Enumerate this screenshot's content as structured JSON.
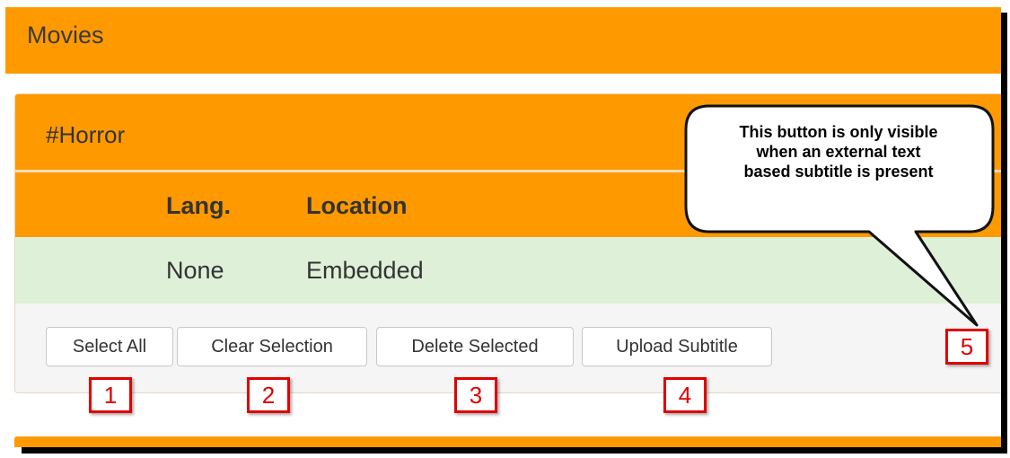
{
  "page": {
    "title": "Movies"
  },
  "panel": {
    "title": "#Horror"
  },
  "table": {
    "headers": [
      "Lang.",
      "Location"
    ],
    "rows": [
      {
        "lang": "None",
        "location": "Embedded"
      }
    ]
  },
  "buttons": {
    "select_all": "Select All",
    "clear_selection": "Clear Selection",
    "delete_selected": "Delete Selected",
    "upload_subtitle": "Upload Subtitle"
  },
  "annotations": {
    "labels": [
      "1",
      "2",
      "3",
      "4",
      "5"
    ],
    "callout": [
      "This button is only visible",
      "when an external text",
      "based subtitle is present"
    ]
  },
  "colors": {
    "accent": "#ff9900",
    "row_highlight": "#dff0d8",
    "annotation_red": "#e00000"
  }
}
